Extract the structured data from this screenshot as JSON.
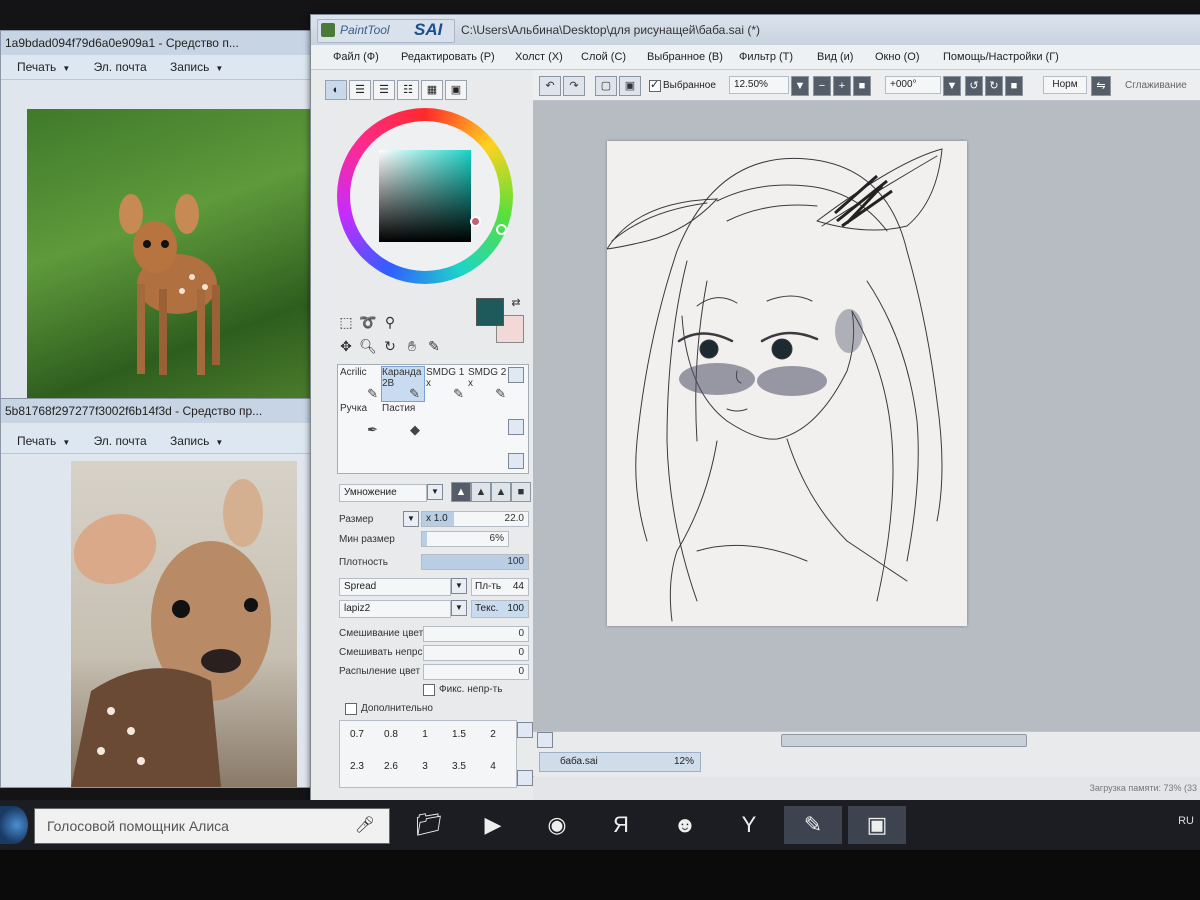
{
  "viewer_top": {
    "title": "1a9bdad094f79d6a0e909a1 - Средство п...",
    "menu": [
      "Печать",
      "Эл. почта",
      "Запись"
    ]
  },
  "viewer_bottom": {
    "title": "5b81768f297277f3002f6b14f3d - Средство пр...",
    "menu": [
      "Печать",
      "Эл. почта",
      "Запись"
    ]
  },
  "sai": {
    "logo_text": "PaintTool",
    "logo_sai": "SAI",
    "title": "C:\\Users\\Альбина\\Desktop\\для рисунащей\\баба.sai (*)",
    "menu": [
      "Файл (Ф)",
      "Редактировать (Р)",
      "Холст (Х)",
      "Слой (С)",
      "Выбранное (В)",
      "Фильтр (Т)",
      "Вид (и)",
      "Окно (О)",
      "Помощь/Настройки (Г)"
    ],
    "toolbar": {
      "selection_label": "Выбранное",
      "selection_checked": true,
      "zoom": "12.50%",
      "rotation": "+000°",
      "mode": "Норм",
      "smoothing_label": "Сглаживание"
    },
    "brushes": [
      {
        "label": "Acrilic",
        "sub": ""
      },
      {
        "label": "Каранда",
        "sub": "2B"
      },
      {
        "label": "SMDG 1",
        "sub": "x"
      },
      {
        "label": "SMDG 2",
        "sub": "x"
      },
      {
        "label": "Ручка",
        "sub": ""
      },
      {
        "label": "Пастия",
        "sub": ""
      }
    ],
    "blend_mode": "Умножение",
    "size_label": "Размер",
    "size_mult": "x 1.0",
    "size_value": "22.0",
    "min_size_label": "Мин размер",
    "min_size_value": "6%",
    "density_label": "Плотность",
    "density_value": "100",
    "shape1": "Spread",
    "shape1_param_label": "Пл-ть",
    "shape1_param": "44",
    "texture": "lapiz2",
    "texture_param_label": "Текс.",
    "texture_param": "100",
    "blend_color_label": "Смешивание цвет",
    "blend_color_value": "0",
    "blend_opacity_label": "Смешивать непрс",
    "blend_opacity_value": "0",
    "spray_label": "Распыление цвет",
    "spray_value": "0",
    "keep_opacity_label": "Фикс. непр-ть",
    "advanced_label": "Дополнительно",
    "sizes": [
      "0.7",
      "0.8",
      "1",
      "1.5",
      "2",
      "2.3",
      "2.6",
      "3",
      "3.5",
      "4"
    ],
    "file_tab": "баба.sai",
    "file_zoom": "12%",
    "status": "Загрузка памяти: 73% (33"
  },
  "taskbar": {
    "search_text": "Голосовой помощник Алиса",
    "tray_text": "RU"
  },
  "colors": {
    "foreground": "#1e5a5c",
    "background": "#f2d8d6"
  }
}
